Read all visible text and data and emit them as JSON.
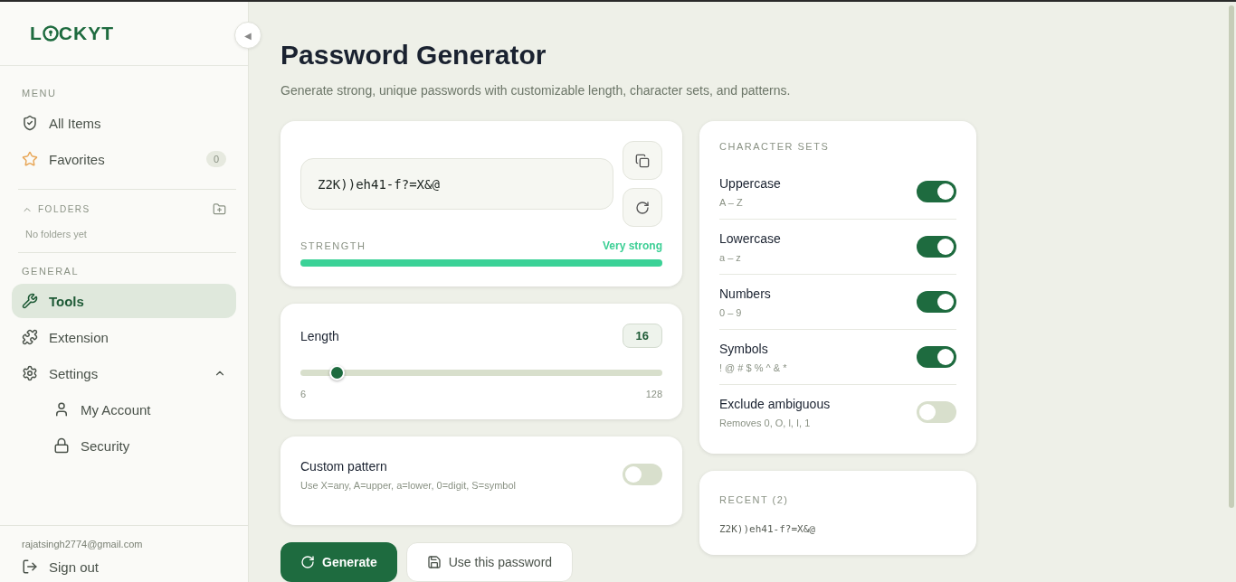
{
  "sidebar": {
    "logo": {
      "before": "L",
      "after": "CKYT"
    },
    "collapse_button": "◀",
    "menu": {
      "heading": "MENU",
      "items": [
        {
          "label": "All Items",
          "kind": "shield",
          "selected": false
        },
        {
          "label": "Favorites",
          "kind": "star",
          "selected": false,
          "count": "0"
        }
      ]
    },
    "folders": {
      "heading": "FOLDERS",
      "expanded": true,
      "empty_text": "No folders yet"
    },
    "general": {
      "heading": "GENERAL",
      "items": [
        {
          "label": "Tools",
          "kind": "wrench",
          "selected": true
        },
        {
          "label": "Extension",
          "kind": "puzzle",
          "selected": false
        },
        {
          "label": "Settings",
          "kind": "gear",
          "selected": false,
          "expanded": true,
          "children": [
            {
              "label": "My Account",
              "kind": "user",
              "selected": false
            },
            {
              "label": "Security",
              "kind": "lock",
              "selected": false
            }
          ]
        }
      ]
    },
    "email": "rajatsingh2774@gmail.com",
    "sign_out": "Sign out"
  },
  "page": {
    "title": "Password Generator",
    "subtitle": "Generate strong, unique passwords with customizable length, character sets, and patterns."
  },
  "generator": {
    "password": "Z2K))eh41-f?=X&@",
    "strength_label": "STRENGTH",
    "strength_text": "Very strong",
    "level": 1
  },
  "length": {
    "label": "Length",
    "value": "16",
    "min": "6",
    "max": "128",
    "level": 0.1
  },
  "custom_pattern": {
    "label": "Custom pattern",
    "hint": "Use X=any, A=upper, a=lower, 0=digit, S=symbol",
    "on": false
  },
  "actions": [
    {
      "label": "Generate",
      "kind": "primary"
    },
    {
      "label": "Use this password",
      "kind": "secondary"
    }
  ],
  "character_sets": {
    "heading": "CHARACTER SETS",
    "items": [
      {
        "label": "Uppercase",
        "hint": "A – Z",
        "on": true
      },
      {
        "label": "Lowercase",
        "hint": "a – z",
        "on": true
      },
      {
        "label": "Numbers",
        "hint": "0 – 9",
        "on": true
      },
      {
        "label": "Symbols",
        "hint": "! @ # $ % ^ & *",
        "on": true
      },
      {
        "label": "Exclude ambiguous",
        "hint": "Removes 0, O, l, I, 1",
        "on": false
      }
    ]
  },
  "recent": {
    "heading": "RECENT (2)",
    "items": [
      "Z2K))eh41-f?=X&@"
    ]
  }
}
